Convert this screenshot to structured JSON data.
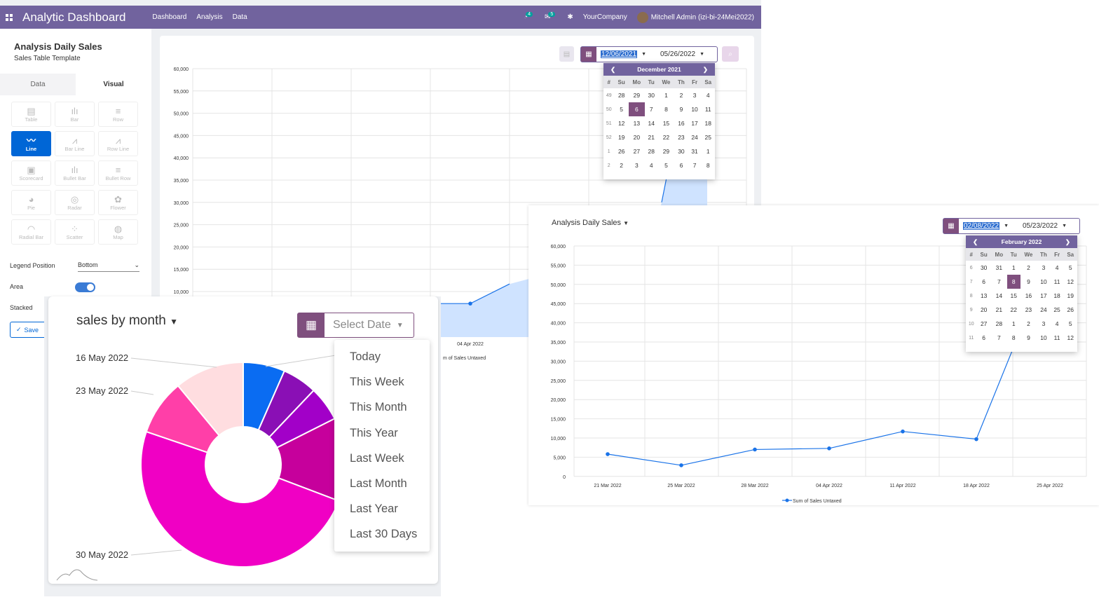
{
  "navbar": {
    "brand": "Analytic Dashboard",
    "menu": [
      "Dashboard",
      "Analysis",
      "Data"
    ],
    "activity_badge": "4",
    "messages_badge": "5",
    "company": "YourCompany",
    "user": "Mitchell Admin (izi-bi-24Mei2022)"
  },
  "sidebar": {
    "title": "Analysis Daily Sales",
    "subtitle": "Sales Table Template",
    "tabs": [
      "Data",
      "Visual"
    ],
    "visuals": [
      {
        "label": "Table",
        "icon": "table-icon"
      },
      {
        "label": "Bar",
        "icon": "bar-chart-icon"
      },
      {
        "label": "Row",
        "icon": "row-chart-icon"
      },
      {
        "label": "Line",
        "icon": "line-chart-icon"
      },
      {
        "label": "Bar Line",
        "icon": "bar-line-icon"
      },
      {
        "label": "Row Line",
        "icon": "row-line-icon"
      },
      {
        "label": "Scorecard",
        "icon": "scorecard-icon"
      },
      {
        "label": "Bullet Bar",
        "icon": "bullet-bar-icon"
      },
      {
        "label": "Bullet Row",
        "icon": "bullet-row-icon"
      },
      {
        "label": "Pie",
        "icon": "pie-icon"
      },
      {
        "label": "Radar",
        "icon": "radar-icon"
      },
      {
        "label": "Flower",
        "icon": "flower-icon"
      },
      {
        "label": "Radial Bar",
        "icon": "radial-bar-icon"
      },
      {
        "label": "Scatter",
        "icon": "scatter-icon"
      },
      {
        "label": "Map",
        "icon": "map-icon"
      }
    ],
    "legend_position_label": "Legend Position",
    "legend_position_value": "Bottom",
    "area_label": "Area",
    "area_on": true,
    "stacked_label": "Stacked",
    "save_label": "Save"
  },
  "main_chart": {
    "start_date": "12/06/2021",
    "end_date": "05/26/2022",
    "visible_x_label": "04 Apr 2022",
    "legend_partial": "m of Sales Untaxed",
    "calendar": {
      "month": "December 2021",
      "weekdays": [
        "#",
        "Su",
        "Mo",
        "Tu",
        "We",
        "Th",
        "Fr",
        "Sa"
      ],
      "rows": [
        [
          "49",
          "28",
          "29",
          "30",
          "1",
          "2",
          "3",
          "4"
        ],
        [
          "50",
          "5",
          "6",
          "7",
          "8",
          "9",
          "10",
          "11"
        ],
        [
          "51",
          "12",
          "13",
          "14",
          "15",
          "16",
          "17",
          "18"
        ],
        [
          "52",
          "19",
          "20",
          "21",
          "22",
          "23",
          "24",
          "25"
        ],
        [
          "1",
          "26",
          "27",
          "28",
          "29",
          "30",
          "31",
          "1"
        ],
        [
          "2",
          "2",
          "3",
          "4",
          "5",
          "6",
          "7",
          "8"
        ]
      ],
      "selected": "6"
    }
  },
  "pie_card": {
    "title": "sales by month",
    "select_placeholder": "Select Date",
    "date_options": [
      "Today",
      "This Week",
      "This Month",
      "This Year",
      "Last Week",
      "Last Month",
      "Last Year",
      "Last 30 Days"
    ],
    "colors": {
      "blue": "#0a6cf2",
      "purple": "#8a0fb5",
      "violet": "#a200c8",
      "magenta": "#c6009c",
      "pink": "#f000c4",
      "hotpink": "#ff3fa8",
      "lightpink": "#ffdde0"
    }
  },
  "chart_data": [
    {
      "type": "line",
      "title": "Analysis Daily Sales",
      "x": [
        "21 Mar 2022",
        "25 Mar 2022",
        "28 Mar 2022",
        "04 Apr 2022",
        "11 Apr 2022",
        "18 Apr 2022",
        "25 Apr 2022"
      ],
      "series": [
        {
          "name": "Sum of Sales Untaxed",
          "values": [
            5800,
            2900,
            7000,
            7300,
            11700,
            9700,
            57000
          ]
        }
      ],
      "y_ticks": [
        "60,000",
        "55,000",
        "50,000",
        "45,000",
        "40,000",
        "35,000",
        "30,000",
        "25,000",
        "20,000",
        "15,000",
        "10,000",
        "5,000",
        "0"
      ],
      "ylim": [
        0,
        60000
      ],
      "legend": "bottom",
      "grid": true
    },
    {
      "type": "line",
      "area": true,
      "y_ticks": [
        "60,000",
        "55,000",
        "50,000",
        "45,000",
        "40,000",
        "35,000",
        "30,000",
        "25,000",
        "20,000",
        "15,000",
        "10,000"
      ],
      "ylim": [
        0,
        60000
      ]
    },
    {
      "type": "pie",
      "labels": [
        "16 May 2022",
        "23 May 2022",
        "30 May 2022"
      ],
      "values": [
        6,
        5,
        5,
        12,
        45,
        8,
        10
      ]
    }
  ],
  "card3": {
    "title": "Analysis Daily Sales",
    "start_date": "02/08/2022",
    "end_date": "05/23/2022",
    "calendar": {
      "month": "February 2022",
      "weekdays": [
        "#",
        "Su",
        "Mo",
        "Tu",
        "We",
        "Th",
        "Fr",
        "Sa"
      ],
      "rows": [
        [
          "6",
          "30",
          "31",
          "1",
          "2",
          "3",
          "4",
          "5"
        ],
        [
          "7",
          "6",
          "7",
          "8",
          "9",
          "10",
          "11",
          "12"
        ],
        [
          "8",
          "13",
          "14",
          "15",
          "16",
          "17",
          "18",
          "19"
        ],
        [
          "9",
          "20",
          "21",
          "22",
          "23",
          "24",
          "25",
          "26"
        ],
        [
          "10",
          "27",
          "28",
          "1",
          "2",
          "3",
          "4",
          "5"
        ],
        [
          "11",
          "6",
          "7",
          "8",
          "9",
          "10",
          "11",
          "12"
        ]
      ],
      "selected": "8"
    }
  }
}
